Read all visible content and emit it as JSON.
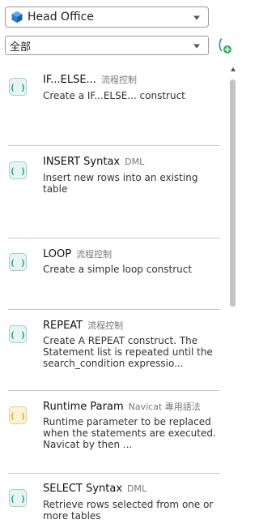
{
  "connection": {
    "label": "Head Office",
    "icon": "connection-icon"
  },
  "category": {
    "label": "全部"
  },
  "add_button": {
    "icon": "add-snippet-icon"
  },
  "snippets": [
    {
      "title": "IF...ELSE...",
      "category": "流程控制",
      "description": "Create a IF...ELSE... construct",
      "color": "#1f9e8f"
    },
    {
      "title": "INSERT Syntax",
      "category": "DML",
      "description": "Insert new rows into an existing table",
      "color": "#1f9e8f"
    },
    {
      "title": "LOOP",
      "category": "流程控制",
      "description": "Create a simple loop construct",
      "color": "#1f9e8f"
    },
    {
      "title": "REPEAT",
      "category": "流程控制",
      "description": "Create A REPEAT construct. The Statement list is repeated until the search_condition expressio...",
      "color": "#1f9e8f"
    },
    {
      "title": "Runtime Param",
      "category": "Navicat 專用語法",
      "description": "Runtime parameter to be replaced when the statements are executed. Navicat by then ...",
      "color": "#e0a814"
    },
    {
      "title": "SELECT Syntax",
      "category": "DML",
      "description": "Retrieve rows selected from one or more tables",
      "color": "#1f9e8f"
    }
  ]
}
